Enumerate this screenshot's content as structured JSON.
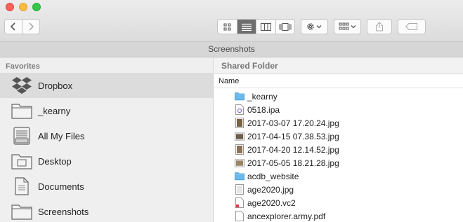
{
  "window": {
    "title": "Screenshots"
  },
  "toolbar": {
    "icons": [
      "back-icon",
      "forward-icon",
      "icon-view-icon",
      "list-view-icon",
      "column-view-icon",
      "cover-flow-icon",
      "gear-icon",
      "arrange-icon",
      "share-icon",
      "tag-icon"
    ],
    "active_view": "list"
  },
  "sidebar": {
    "heading": "Favorites",
    "items": [
      {
        "label": "Dropbox",
        "icon": "dropbox-icon",
        "selected": true
      },
      {
        "label": "_kearny",
        "icon": "folder-icon"
      },
      {
        "label": "All My Files",
        "icon": "all-files-icon"
      },
      {
        "label": "Desktop",
        "icon": "desktop-folder-icon"
      },
      {
        "label": "Documents",
        "icon": "documents-folder-icon"
      },
      {
        "label": "Screenshots",
        "icon": "folder-icon"
      }
    ]
  },
  "content": {
    "header": "Shared Folder",
    "column_name": "Name",
    "files": [
      {
        "name": "_kearny",
        "icon": "folder-icon"
      },
      {
        "name": "0518.ipa",
        "icon": "ipa-file-icon"
      },
      {
        "name": "2017-03-07 17.20.24.jpg",
        "icon": "image-file-icon"
      },
      {
        "name": "2017-04-15 07.38.53.jpg",
        "icon": "image-file-icon"
      },
      {
        "name": "2017-04-20 12.14.52.jpg",
        "icon": "image-file-icon"
      },
      {
        "name": "2017-05-05 18.21.28.jpg",
        "icon": "image-file-icon"
      },
      {
        "name": "acdb_website",
        "icon": "folder-icon"
      },
      {
        "name": "age2020.jpg",
        "icon": "image-file-icon"
      },
      {
        "name": "age2020.vc2",
        "icon": "document-file-icon"
      },
      {
        "name": "ancexplorer.army.pdf",
        "icon": "pdf-file-icon"
      }
    ]
  },
  "colors": {
    "folder": "#6bb8ee",
    "selected": "#dcdcdc",
    "active_view": "#6e6e6e"
  }
}
